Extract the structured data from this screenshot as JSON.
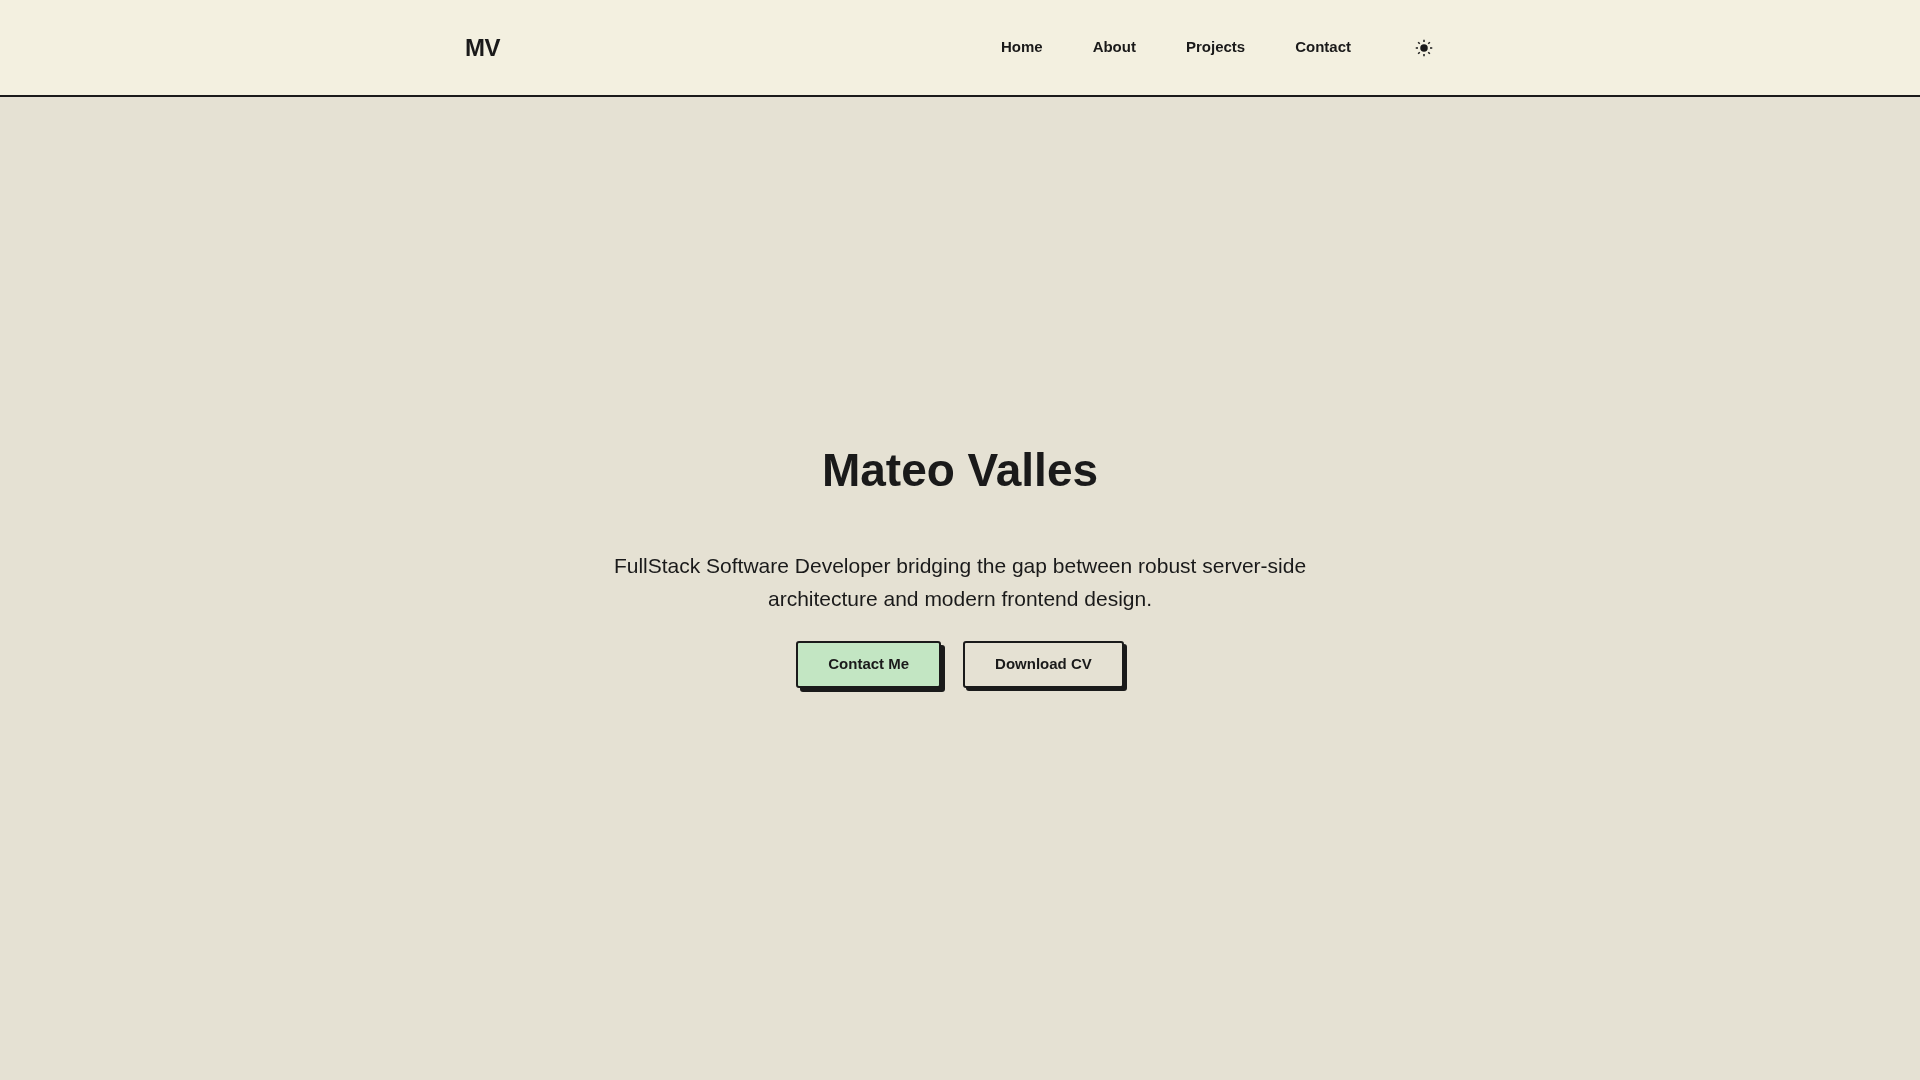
{
  "header": {
    "logo": "MV",
    "nav": [
      {
        "label": "Home"
      },
      {
        "label": "About"
      },
      {
        "label": "Projects"
      },
      {
        "label": "Contact"
      }
    ],
    "theme_toggle": {
      "kind": "light"
    }
  },
  "hero": {
    "title": "Mateo Valles",
    "description": "FullStack Software Developer bridging the gap between robust server-side architecture and modern frontend design.",
    "buttons": [
      {
        "label": "Contact Me",
        "kind": "primary"
      },
      {
        "label": "Download CV",
        "kind": "secondary"
      }
    ]
  }
}
